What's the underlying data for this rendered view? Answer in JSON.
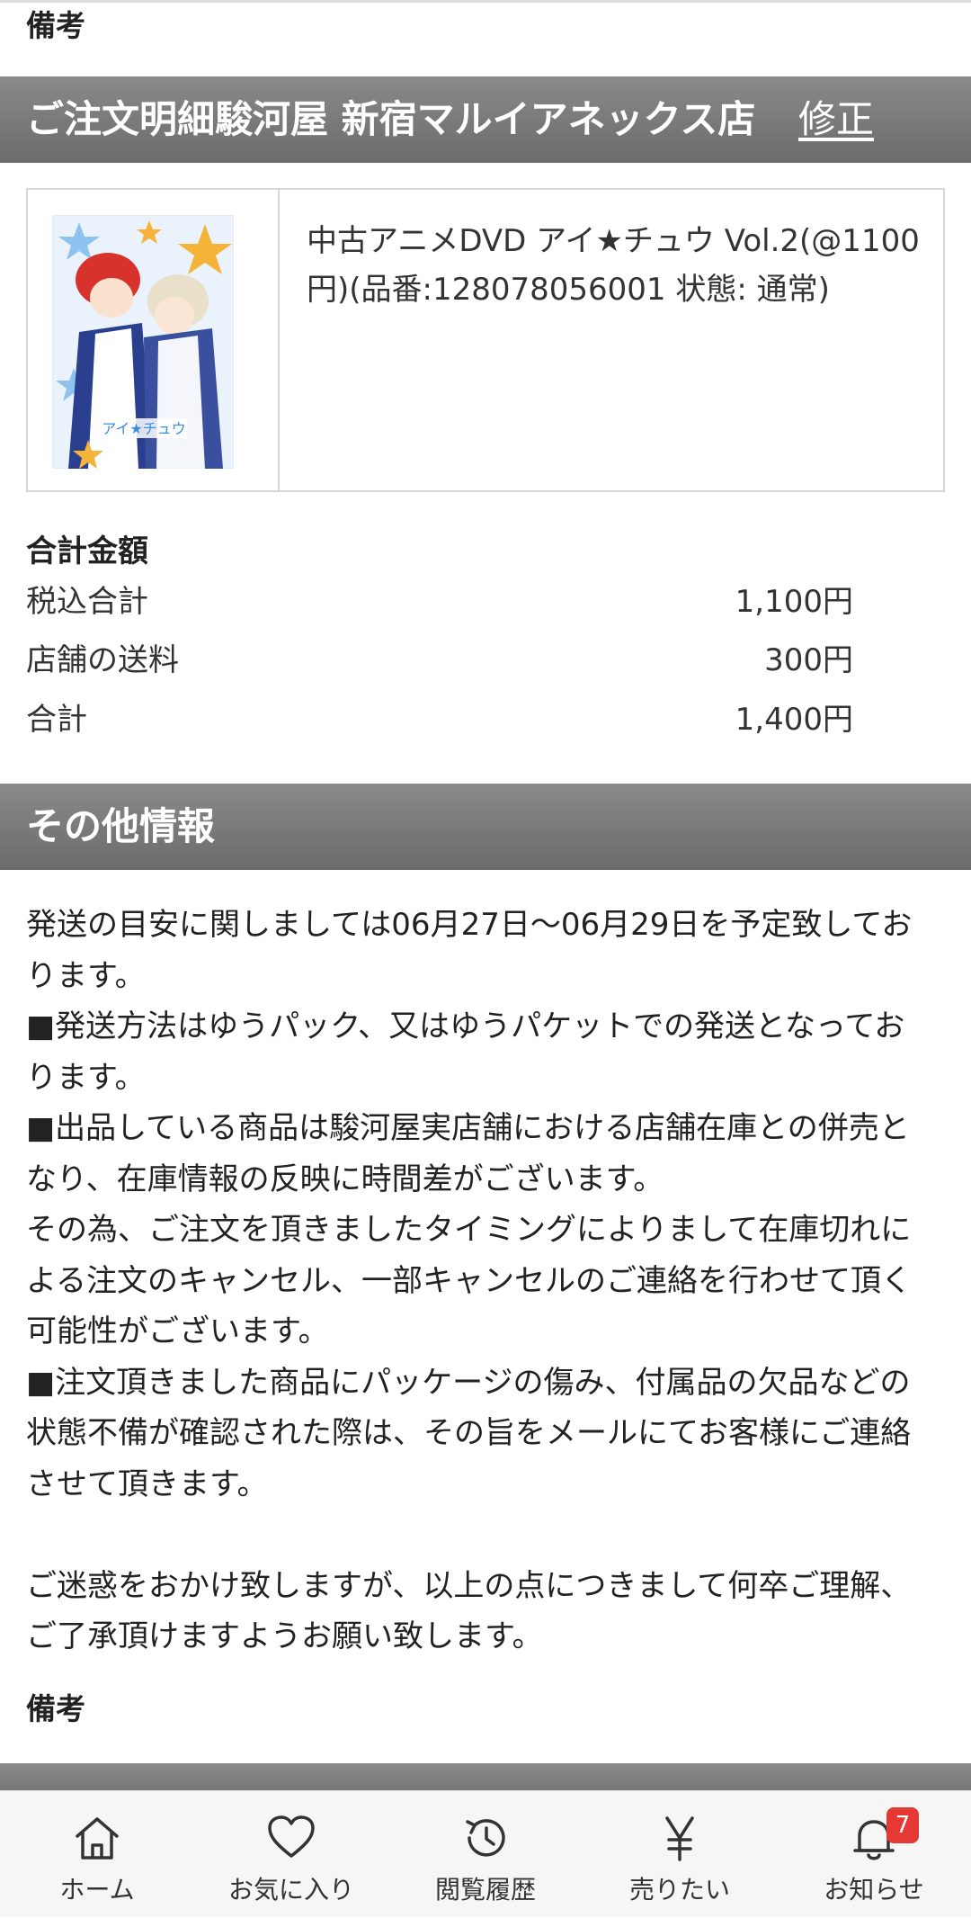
{
  "remarks_top": "備考",
  "order_section": {
    "title": "ご注文明細駿河屋 新宿マルイアネックス店",
    "edit_label": "修正"
  },
  "product": {
    "description": "中古アニメDVD アイ★チュウ Vol.2(@1100円)(品番:128078056001 状態: 通常)"
  },
  "totals": {
    "heading": "合計金額",
    "rows": [
      {
        "label": "税込合計",
        "value": "1,100円"
      },
      {
        "label": "店舗の送料",
        "value": "300円"
      },
      {
        "label": "合計",
        "value": "1,400円"
      }
    ]
  },
  "other_info": {
    "title": "その他情報",
    "body": "発送の目安に関しましては06月27日〜06月29日を予定致しております。\n■発送方法はゆうパック、又はゆうパケットでの発送となっております。\n■出品している商品は駿河屋実店舗における店舗在庫との併売となり、在庫情報の反映に時間差がございます。\nその為、ご注文を頂きましたタイミングによりまして在庫切れによる注文のキャンセル、一部キャンセルのご連絡を行わせて頂く可能性がございます。\n■注文頂きました商品にパッケージの傷み、付属品の欠品などの状態不備が確認された際は、その旨をメールにてお客様にご連絡させて頂きます。\n\nご迷惑をおかけ致しますが、以上の点につきまして何卒ご理解、ご了承頂けますようお願い致します。"
  },
  "remarks_bottom": "備考",
  "tabbar": {
    "items": [
      {
        "label": "ホーム",
        "icon": "home-icon"
      },
      {
        "label": "お気に入り",
        "icon": "heart-icon"
      },
      {
        "label": "閲覧履歴",
        "icon": "history-icon"
      },
      {
        "label": "売りたい",
        "icon": "yen-icon"
      },
      {
        "label": "お知らせ",
        "icon": "bell-icon",
        "badge": "7"
      }
    ]
  },
  "colors": {
    "section_bar": "#7a7a7a",
    "badge": "#e53935"
  }
}
